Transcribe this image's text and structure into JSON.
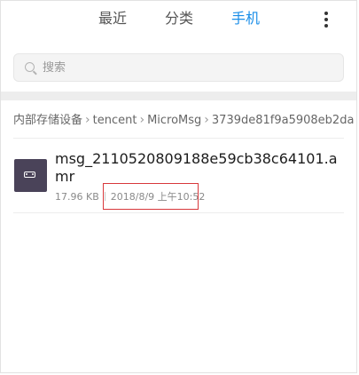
{
  "tabs": {
    "recent": "最近",
    "category": "分类",
    "phone": "手机",
    "active": "phone"
  },
  "colors": {
    "accent": "#1a8ee8",
    "file_icon_bg": "#4a4359",
    "highlight": "#d8383b"
  },
  "search": {
    "placeholder": "搜索",
    "value": ""
  },
  "breadcrumb": {
    "items": [
      "内部存储设备",
      "tencent",
      "MicroMsg",
      "3739de81f9a5908eb2da"
    ]
  },
  "file": {
    "icon": "audio-file-icon",
    "name": "msg_2110520809188e59cb38c64101.amr",
    "size": "17.96 KB",
    "date": "2018/8/9 上午10:52"
  }
}
